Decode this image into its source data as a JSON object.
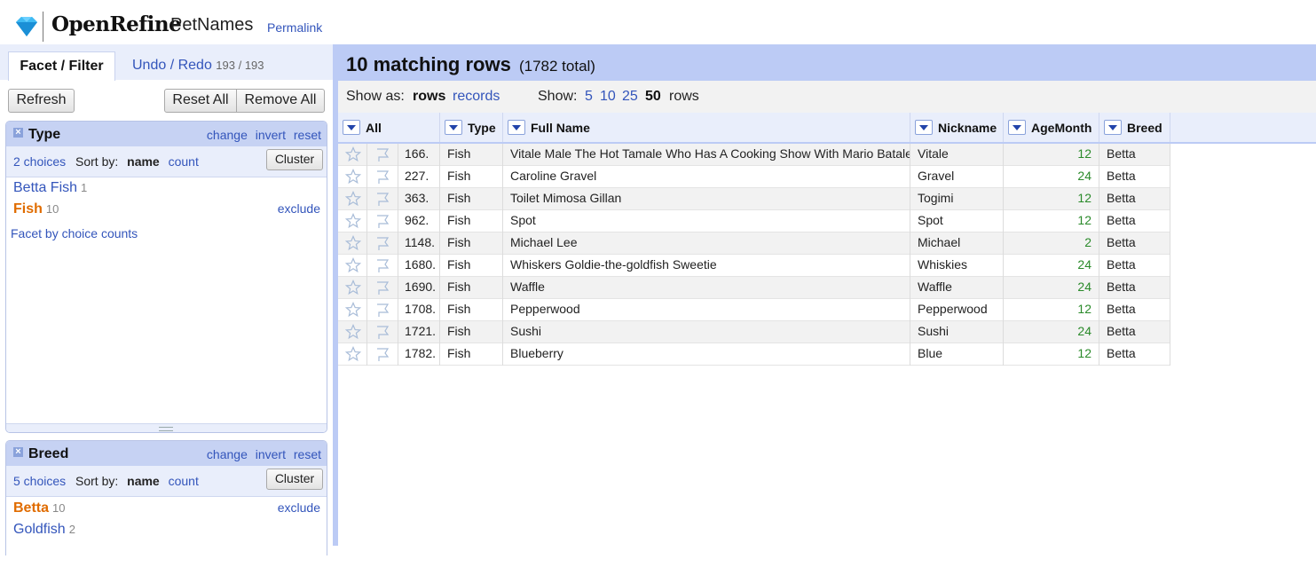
{
  "header": {
    "app_name": "OpenRefine",
    "project_name": "PetNames",
    "permalink": "Permalink"
  },
  "left_panel": {
    "tabs": {
      "facet_filter": "Facet / Filter",
      "undo_redo": "Undo / Redo",
      "undo_count": "193 / 193"
    },
    "buttons": {
      "refresh": "Refresh",
      "reset_all": "Reset All",
      "remove_all": "Remove All"
    },
    "facets": [
      {
        "name": "Type",
        "actions": [
          "change",
          "invert",
          "reset"
        ],
        "choices_label": "2 choices",
        "sort_by_label": "Sort by:",
        "sort_name": "name",
        "sort_count": "count",
        "cluster": "Cluster",
        "choices": [
          {
            "name": "Betta Fish",
            "count": "1",
            "selected": false
          },
          {
            "name": "Fish",
            "count": "10",
            "selected": true,
            "exclude": "exclude"
          }
        ],
        "facet_by_counts": "Facet by choice counts"
      },
      {
        "name": "Breed",
        "actions": [
          "change",
          "invert",
          "reset"
        ],
        "choices_label": "5 choices",
        "sort_by_label": "Sort by:",
        "sort_name": "name",
        "sort_count": "count",
        "cluster": "Cluster",
        "choices": [
          {
            "name": "Betta",
            "count": "10",
            "selected": true,
            "exclude": "exclude"
          },
          {
            "name": "Goldfish",
            "count": "2",
            "selected": false
          }
        ]
      }
    ]
  },
  "summary": {
    "matching": "10 matching rows",
    "total": "(1782 total)"
  },
  "view_bar": {
    "show_as_label": "Show as:",
    "rows": "rows",
    "records": "records",
    "show_label": "Show:",
    "page_sizes": [
      "5",
      "10",
      "25",
      "50"
    ],
    "current_page_size": "50",
    "rows_suffix": "rows"
  },
  "grid": {
    "columns": [
      "All",
      "Type",
      "Full Name",
      "Nickname",
      "AgeMonth",
      "Breed"
    ],
    "rows": [
      {
        "index": "166.",
        "type": "Fish",
        "full_name": "Vitale Male The Hot Tamale Who Has A Cooking Show With Mario Batale",
        "nickname": "Vitale",
        "age": "12",
        "breed": "Betta"
      },
      {
        "index": "227.",
        "type": "Fish",
        "full_name": "Caroline Gravel",
        "nickname": "Gravel",
        "age": "24",
        "breed": "Betta"
      },
      {
        "index": "363.",
        "type": "Fish",
        "full_name": "Toilet Mimosa Gillan",
        "nickname": "Togimi",
        "age": "12",
        "breed": "Betta"
      },
      {
        "index": "962.",
        "type": "Fish",
        "full_name": "Spot",
        "nickname": "Spot",
        "age": "12",
        "breed": "Betta"
      },
      {
        "index": "1148.",
        "type": "Fish",
        "full_name": "Michael Lee",
        "nickname": "Michael",
        "age": "2",
        "breed": "Betta"
      },
      {
        "index": "1680.",
        "type": "Fish",
        "full_name": "Whiskers Goldie-the-goldfish Sweetie",
        "nickname": "Whiskies",
        "age": "24",
        "breed": "Betta"
      },
      {
        "index": "1690.",
        "type": "Fish",
        "full_name": "Waffle",
        "nickname": "Waffle",
        "age": "24",
        "breed": "Betta"
      },
      {
        "index": "1708.",
        "type": "Fish",
        "full_name": "Pepperwood",
        "nickname": "Pepperwood",
        "age": "12",
        "breed": "Betta"
      },
      {
        "index": "1721.",
        "type": "Fish",
        "full_name": "Sushi",
        "nickname": "Sushi",
        "age": "24",
        "breed": "Betta"
      },
      {
        "index": "1782.",
        "type": "Fish",
        "full_name": "Blueberry",
        "nickname": "Blue",
        "age": "12",
        "breed": "Betta"
      }
    ]
  },
  "icons": {
    "logo": "diamond-logo-icon",
    "star": "star-icon",
    "flag": "flag-icon",
    "dropdown": "dropdown-arrow-icon",
    "close": "close-icon"
  },
  "colors": {
    "accent": "#3355bb",
    "header_bar": "#bccbf5",
    "facet_title": "#c6d2f3",
    "selected_choice": "#e06c00",
    "age_value": "#2a8a2a"
  }
}
